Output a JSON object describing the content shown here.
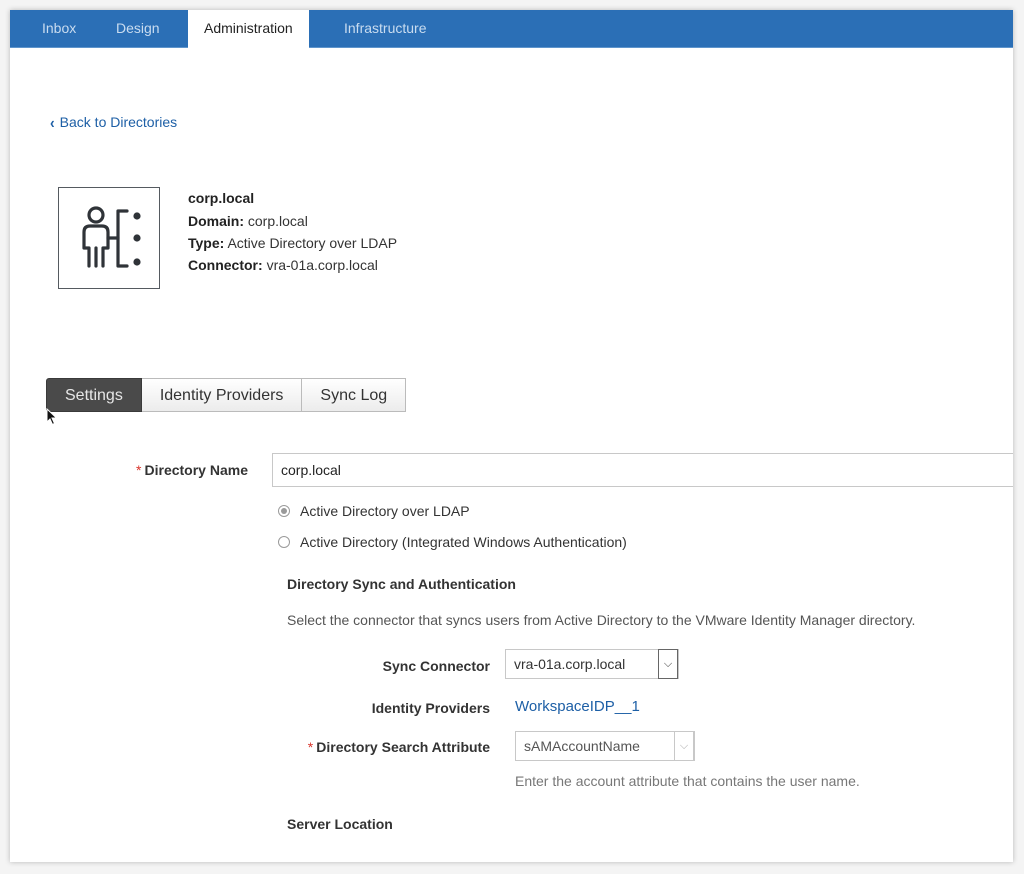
{
  "top_nav": {
    "tabs": [
      {
        "label": "Inbox",
        "active": false
      },
      {
        "label": "Design",
        "active": false
      },
      {
        "label": "Administration",
        "active": true
      },
      {
        "label": "Infrastructure",
        "active": false
      }
    ]
  },
  "back_link": {
    "label": "Back to Directories",
    "icon": "chevron-left-icon"
  },
  "directory": {
    "icon": "directory-user-icon",
    "name": "corp.local",
    "domain_label": "Domain:",
    "domain_value": "corp.local",
    "type_label": "Type:",
    "type_value": "Active Directory over LDAP",
    "connector_label": "Connector:",
    "connector_value": "vra-01a.corp.local"
  },
  "sub_tabs": [
    {
      "label": "Settings",
      "active": true
    },
    {
      "label": "Identity Providers",
      "active": false
    },
    {
      "label": "Sync Log",
      "active": false
    }
  ],
  "form": {
    "required_mark": "*",
    "directory_name": {
      "label": "Directory Name",
      "value": "corp.local"
    },
    "directory_type_options": [
      {
        "label": "Active Directory over LDAP",
        "checked": true
      },
      {
        "label": "Active Directory (Integrated Windows Authentication)",
        "checked": false
      }
    ],
    "sync_section": {
      "title": "Directory Sync and Authentication",
      "description": "Select the connector that syncs users from Active Directory to the VMware Identity Manager directory."
    },
    "sync_connector": {
      "label": "Sync Connector",
      "value": "vra-01a.corp.local"
    },
    "identity_providers": {
      "label": "Identity Providers",
      "value": "WorkspaceIDP__1"
    },
    "search_attribute": {
      "label": "Directory Search Attribute",
      "value": "sAMAccountName",
      "hint": "Enter the account attribute that contains the user name."
    },
    "server_location": {
      "title": "Server Location"
    }
  },
  "colors": {
    "nav_bg": "#2b6fb6",
    "link": "#1d5fa6",
    "required": "#d9342b",
    "active_subtab": "#4a4a4a"
  }
}
